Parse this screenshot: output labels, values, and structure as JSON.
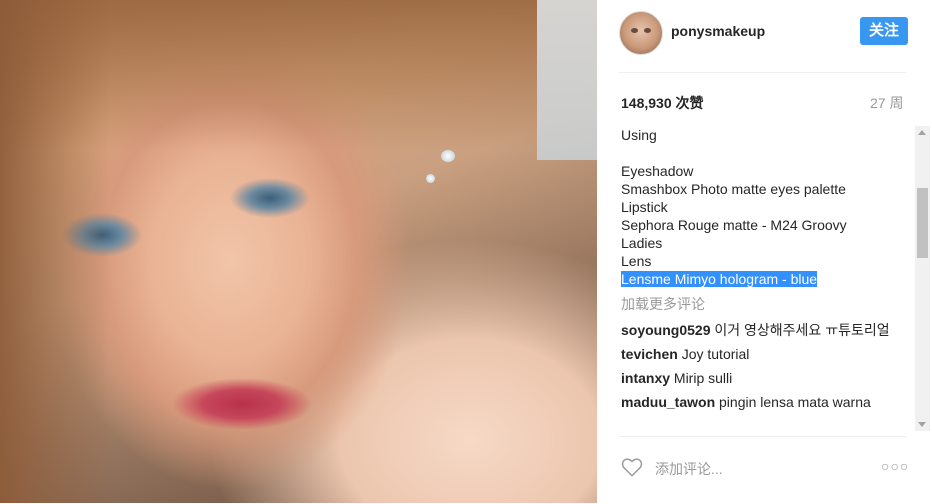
{
  "post": {
    "username": "ponysmakeup",
    "follow_label": "关注",
    "likes": "148,930 次赞",
    "age": "27 周"
  },
  "caption": {
    "lines": [
      "Using",
      "",
      "Eyeshadow",
      "Smashbox Photo matte eyes palette",
      "Lipstick",
      "Sephora Rouge matte - M24 Groovy",
      "Ladies",
      "Lens",
      "Lensme Mimyo hologram - blue"
    ]
  },
  "load_more": "加载更多评论",
  "comments": [
    {
      "user": "soyoung0529",
      "text": "이거 영상해주세요 ㅠ튜토리얼"
    },
    {
      "user": "tevichen",
      "text": "Joy tutorial"
    },
    {
      "user": "intanxy",
      "text": "Mirip sulli"
    },
    {
      "user": "maduu_tawon",
      "text": "pingin lensa mata warna"
    }
  ],
  "footer": {
    "add_comment_placeholder": "添加评论...",
    "more_options": "○○○",
    "heart_icon": "heart-outline-icon"
  },
  "colors": {
    "follow_button": "#3897f0",
    "selection": "#3390ff"
  }
}
